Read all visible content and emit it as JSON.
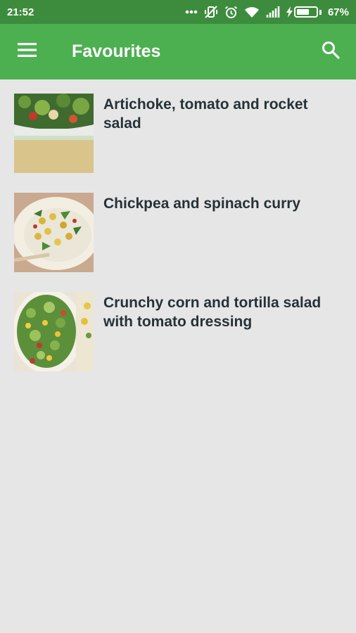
{
  "status_bar": {
    "time": "21:52",
    "battery_percent": "67%",
    "battery_level": 0.67
  },
  "app_bar": {
    "title": "Favourites"
  },
  "favourites": [
    {
      "title": "Artichoke, tomato and rocket salad"
    },
    {
      "title": "Chickpea and spinach curry"
    },
    {
      "title": "Crunchy corn and tortilla salad with tomato dressing"
    }
  ],
  "colors": {
    "status_bar": "#3d8c3d",
    "app_bar": "#4caf50",
    "background": "#e6e6e6",
    "title_text": "#263238"
  }
}
